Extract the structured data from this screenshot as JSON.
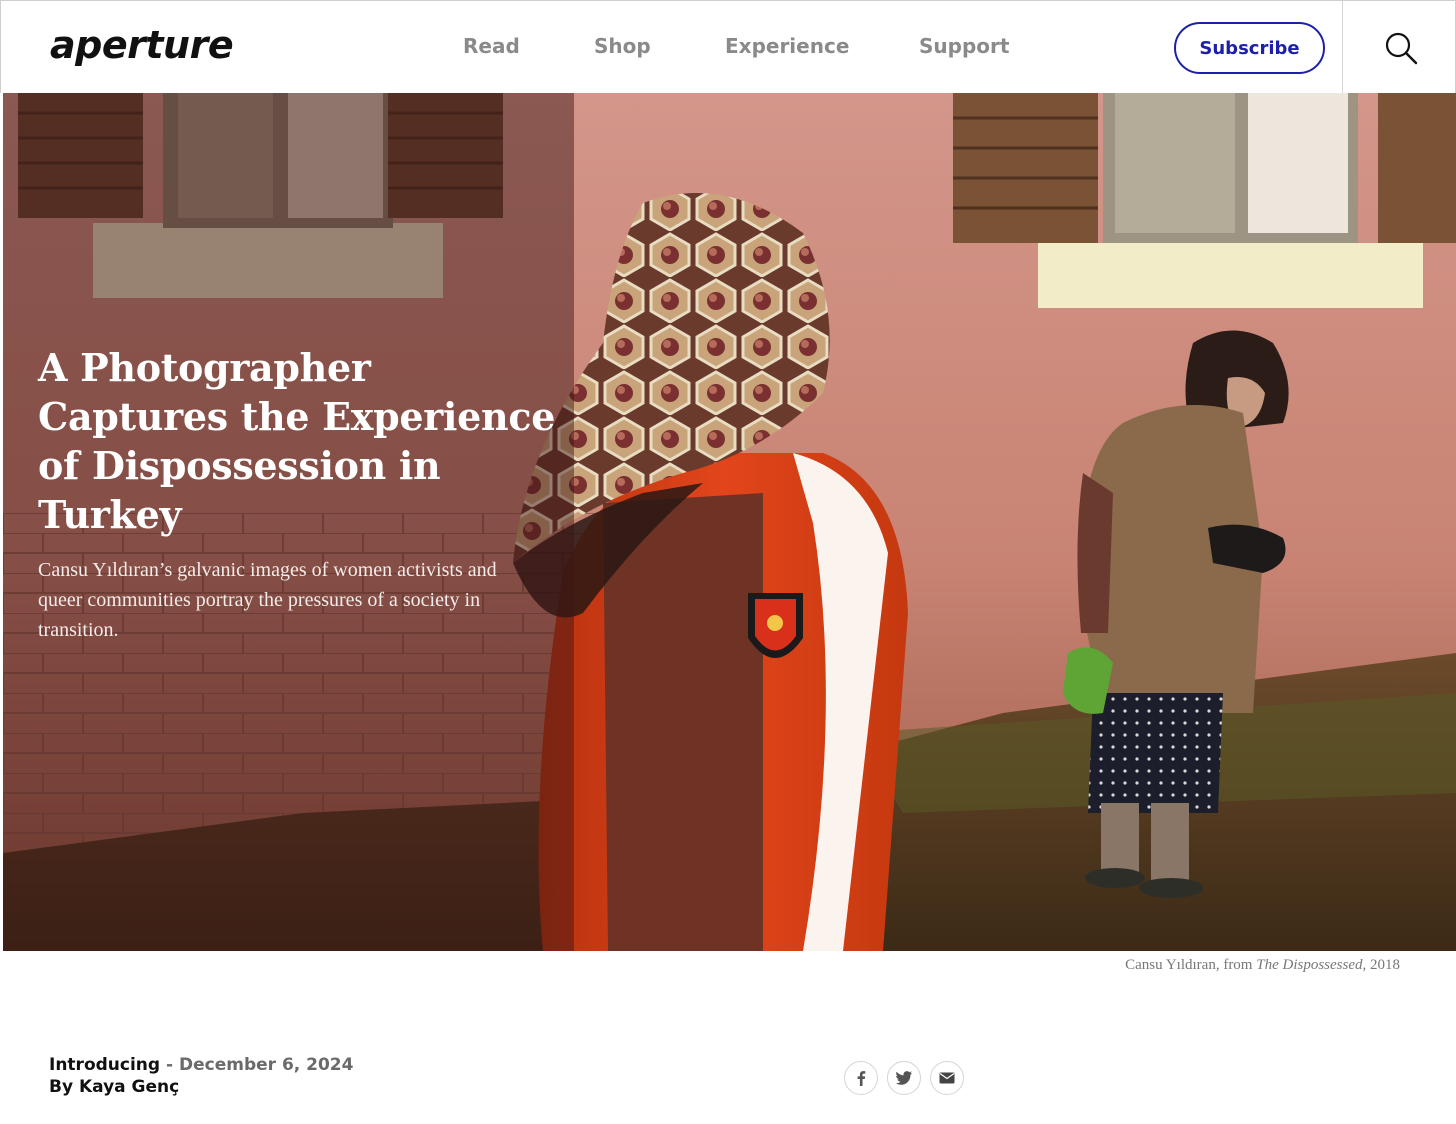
{
  "header": {
    "logo": "aperture",
    "nav": [
      {
        "label": "Read"
      },
      {
        "label": "Shop"
      },
      {
        "label": "Experience"
      },
      {
        "label": "Support"
      }
    ],
    "subscribe_label": "Subscribe",
    "search_icon": "search-icon"
  },
  "hero": {
    "title": "A Photographer Captures the Experience of Dispossession in Turkey",
    "dek": "Cansu Yıldıran’s galvanic images of women activists and queer communities portray the pressures of a society in transition.",
    "caption": {
      "prefix": "Cansu Yıldıran, from ",
      "work": "The Dispossessed",
      "suffix": ", 2018"
    }
  },
  "article_meta": {
    "category": "Introducing",
    "separator": " - ",
    "date": "December 6, 2024",
    "author": "By Kaya Genç"
  },
  "share": {
    "icons": [
      "facebook-icon",
      "twitter-icon",
      "email-icon"
    ]
  },
  "colors": {
    "accent": "#1d20a8",
    "nav_text": "#8a8a8a",
    "wall": "#c98e80",
    "jacket": "#e0431c"
  }
}
